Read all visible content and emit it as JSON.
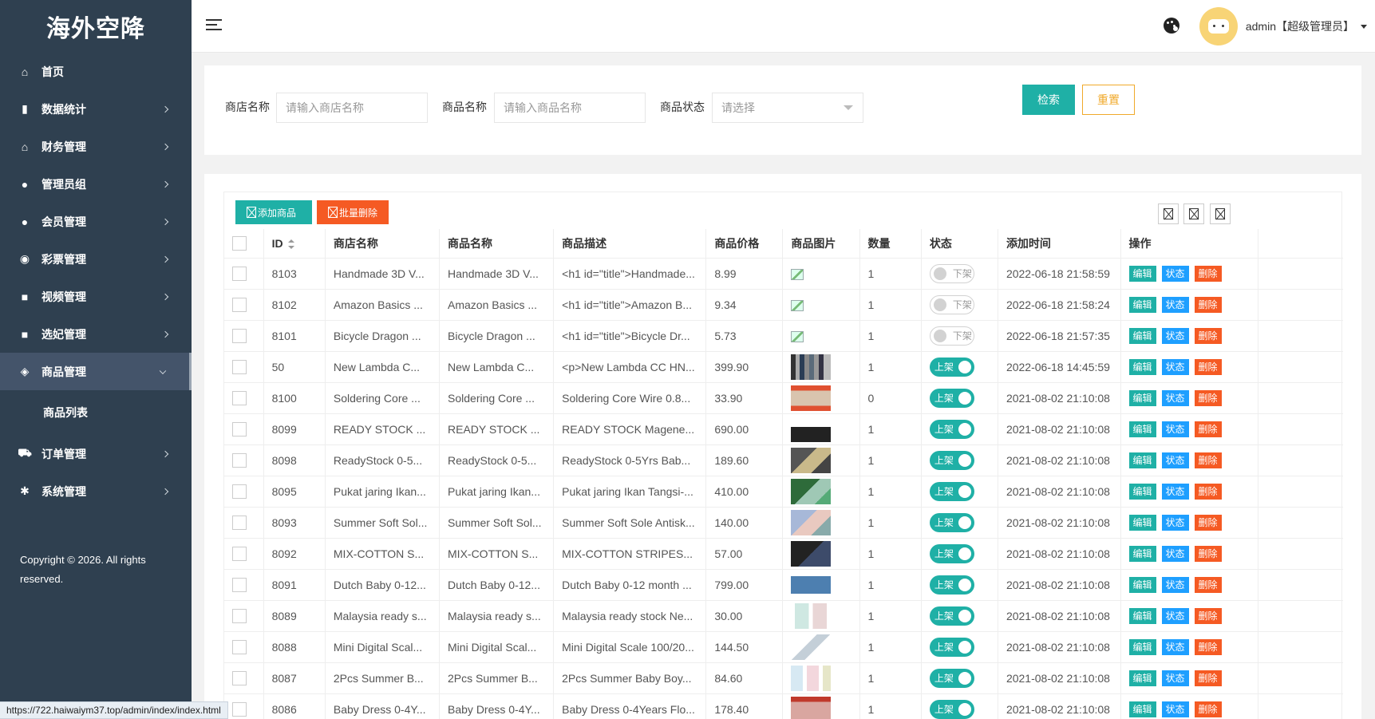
{
  "app": {
    "logo": "海外空降"
  },
  "sidebar": {
    "items": [
      {
        "label": "首页",
        "icon": "home-icon"
      },
      {
        "label": "数据统计",
        "icon": "bar-chart-icon"
      },
      {
        "label": "财务管理",
        "icon": "bank-icon"
      },
      {
        "label": "管理员组",
        "icon": "user-icon"
      },
      {
        "label": "会员管理",
        "icon": "users-icon"
      },
      {
        "label": "彩票管理",
        "icon": "gamepad-icon"
      },
      {
        "label": "视频管理",
        "icon": "video-icon"
      },
      {
        "label": "选妃管理",
        "icon": "video-icon"
      },
      {
        "label": "商品管理",
        "icon": "cube-icon"
      },
      {
        "label": "订单管理",
        "icon": "cart-icon"
      },
      {
        "label": "系统管理",
        "icon": "gear-icon"
      }
    ],
    "sub_item": "商品列表",
    "copyright": "Copyright © 2026. All rights reserved."
  },
  "header": {
    "user": "admin【超级管理员】"
  },
  "filter": {
    "shop_label": "商店名称",
    "shop_placeholder": "请输入商店名称",
    "product_label": "商品名称",
    "product_placeholder": "请输入商品名称",
    "status_label": "商品状态",
    "status_placeholder": "请选择",
    "search": "检索",
    "reset": "重置"
  },
  "toolbar": {
    "add": "添加商品",
    "batch_delete": "批量删除"
  },
  "table": {
    "columns": [
      "ID",
      "商店名称",
      "商品名称",
      "商品描述",
      "商品价格",
      "商品图片",
      "数量",
      "状态",
      "添加时间",
      "操作"
    ],
    "actions": {
      "edit": "编辑",
      "state": "状态",
      "delete": "删除"
    },
    "rows": [
      {
        "id": "8103",
        "shop": "Handmade 3D V...",
        "name": "Handmade 3D V...",
        "desc": "<h1 id=\"title\">Handmade...",
        "price": "8.99",
        "qty": "1",
        "status": "下架",
        "on": false,
        "time": "2022-06-18 21:58:59"
      },
      {
        "id": "8102",
        "shop": "Amazon Basics ...",
        "name": "Amazon Basics ...",
        "desc": "<h1 id=\"title\">Amazon B...",
        "price": "9.34",
        "qty": "1",
        "status": "下架",
        "on": false,
        "time": "2022-06-18 21:58:24"
      },
      {
        "id": "8101",
        "shop": "Bicycle Dragon ...",
        "name": "Bicycle Dragon ...",
        "desc": "<h1 id=\"title\">Bicycle Dr...",
        "price": "5.73",
        "qty": "1",
        "status": "下架",
        "on": false,
        "time": "2022-06-18 21:57:35"
      },
      {
        "id": "50",
        "shop": "New Lambda C...",
        "name": "New Lambda C...",
        "desc": "<p>New Lambda CC HN...",
        "price": "399.90",
        "qty": "1",
        "status": "上架",
        "on": true,
        "time": "2022-06-18 14:45:59"
      },
      {
        "id": "8100",
        "shop": "Soldering Core ...",
        "name": "Soldering Core ...",
        "desc": "Soldering Core Wire 0.8...",
        "price": "33.90",
        "qty": "0",
        "status": "上架",
        "on": true,
        "time": "2021-08-02 21:10:08"
      },
      {
        "id": "8099",
        "shop": "READY STOCK ...",
        "name": "READY STOCK ...",
        "desc": "READY STOCK Magene...",
        "price": "690.00",
        "qty": "1",
        "status": "上架",
        "on": true,
        "time": "2021-08-02 21:10:08"
      },
      {
        "id": "8098",
        "shop": "ReadyStock 0-5...",
        "name": "ReadyStock 0-5...",
        "desc": "ReadyStock 0-5Yrs Bab...",
        "price": "189.60",
        "qty": "1",
        "status": "上架",
        "on": true,
        "time": "2021-08-02 21:10:08"
      },
      {
        "id": "8095",
        "shop": "Pukat jaring Ikan...",
        "name": "Pukat jaring Ikan...",
        "desc": "Pukat jaring Ikan Tangsi-...",
        "price": "410.00",
        "qty": "1",
        "status": "上架",
        "on": true,
        "time": "2021-08-02 21:10:08"
      },
      {
        "id": "8093",
        "shop": "Summer Soft Sol...",
        "name": "Summer Soft Sol...",
        "desc": "Summer Soft Sole Antisk...",
        "price": "140.00",
        "qty": "1",
        "status": "上架",
        "on": true,
        "time": "2021-08-02 21:10:08"
      },
      {
        "id": "8092",
        "shop": "MIX-COTTON S...",
        "name": "MIX-COTTON S...",
        "desc": "MIX-COTTON STRIPES...",
        "price": "57.00",
        "qty": "1",
        "status": "上架",
        "on": true,
        "time": "2021-08-02 21:10:08"
      },
      {
        "id": "8091",
        "shop": "Dutch Baby 0-12...",
        "name": "Dutch Baby 0-12...",
        "desc": "Dutch Baby 0-12 month ...",
        "price": "799.00",
        "qty": "1",
        "status": "上架",
        "on": true,
        "time": "2021-08-02 21:10:08"
      },
      {
        "id": "8089",
        "shop": "Malaysia ready s...",
        "name": "Malaysia ready s...",
        "desc": "Malaysia ready stock Ne...",
        "price": "30.00",
        "qty": "1",
        "status": "上架",
        "on": true,
        "time": "2021-08-02 21:10:08"
      },
      {
        "id": "8088",
        "shop": "Mini Digital Scal...",
        "name": "Mini Digital Scal...",
        "desc": "Mini Digital Scale 100/20...",
        "price": "144.50",
        "qty": "1",
        "status": "上架",
        "on": true,
        "time": "2021-08-02 21:10:08"
      },
      {
        "id": "8087",
        "shop": "2Pcs Summer B...",
        "name": "2Pcs Summer B...",
        "desc": "2Pcs Summer Baby Boy...",
        "price": "84.60",
        "qty": "1",
        "status": "上架",
        "on": true,
        "time": "2021-08-02 21:10:08"
      },
      {
        "id": "8086",
        "shop": "Baby Dress 0-4Y...",
        "name": "Baby Dress 0-4Y...",
        "desc": "Baby Dress 0-4Years Flo...",
        "price": "178.40",
        "qty": "1",
        "status": "上架",
        "on": true,
        "time": "2021-08-02 21:10:08"
      }
    ]
  },
  "browser": {
    "status_url": "https://722.haiwaiym37.top/admin/index/index.html"
  },
  "colors": {
    "sidebar": "#2f4050",
    "primary": "#1fb0a6",
    "danger": "#f55a23",
    "info": "#1e9fff",
    "warning": "#f0a92a"
  }
}
